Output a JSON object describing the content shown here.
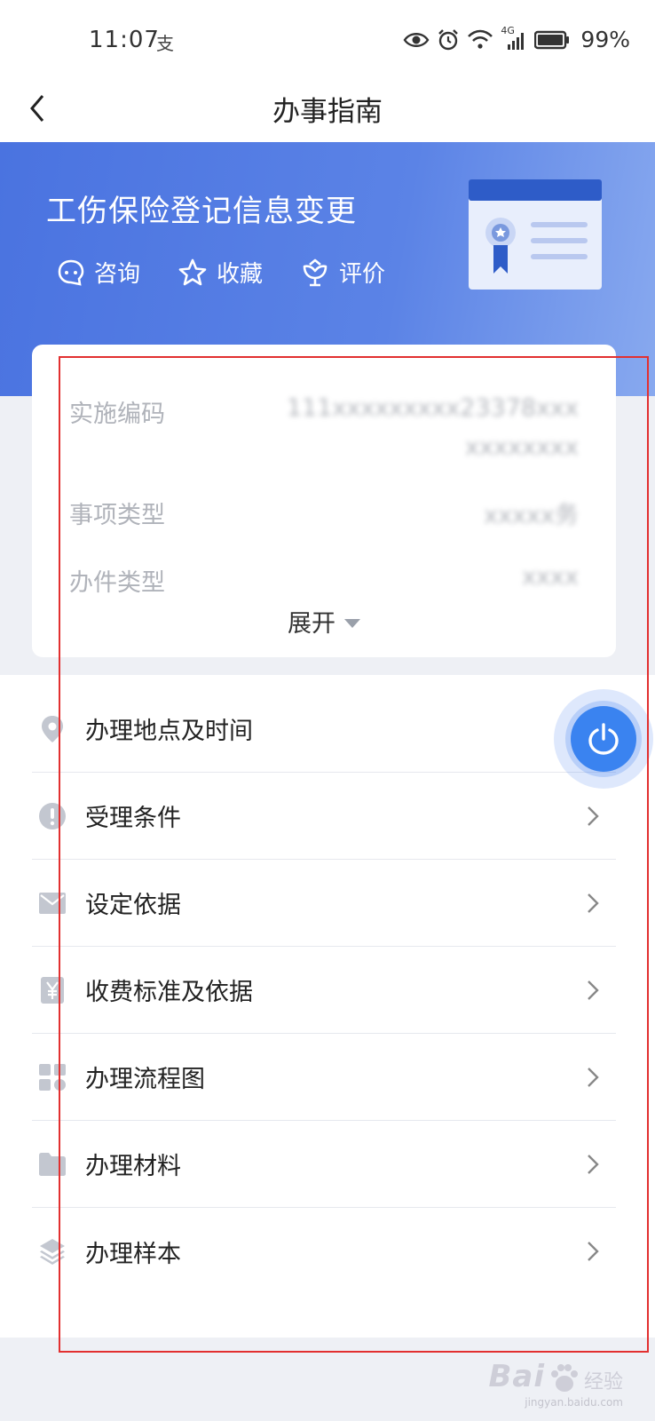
{
  "status_bar": {
    "time": "11:07",
    "time_glyph": "支",
    "network": "4G",
    "battery": "99%"
  },
  "nav": {
    "title": "办事指南",
    "back_icon": "chevron-left-icon"
  },
  "hero": {
    "title": "工伤保险登记信息变更",
    "actions": [
      {
        "label": "咨询",
        "icon": "chat-icon"
      },
      {
        "label": "收藏",
        "icon": "star-icon"
      },
      {
        "label": "评价",
        "icon": "flower-icon"
      }
    ],
    "gradient": [
      "#4a73e0",
      "#88a9ef"
    ]
  },
  "info_card": {
    "rows": [
      {
        "label": "实施编码",
        "value": "111xxxxxxxxx23378xxx\nxxxxxxxx"
      },
      {
        "label": "事项类型",
        "value": "xxxxx务"
      },
      {
        "label": "办件类型",
        "value": "xxxx"
      }
    ],
    "expand_label": "展开"
  },
  "menu": {
    "items": [
      {
        "label": "办理地点及时间",
        "icon": "location-pin-icon"
      },
      {
        "label": "受理条件",
        "icon": "exclamation-circle-icon"
      },
      {
        "label": "设定依据",
        "icon": "envelope-icon"
      },
      {
        "label": "收费标准及依据",
        "icon": "yuan-icon"
      },
      {
        "label": "办理流程图",
        "icon": "grid-icon"
      },
      {
        "label": "办理材料",
        "icon": "folder-icon"
      },
      {
        "label": "办理样本",
        "icon": "layers-icon"
      }
    ]
  },
  "watermark": {
    "main": "Bai",
    "sub": "经验",
    "url": "jingyan.baidu.com"
  },
  "colors": {
    "accent": "#3a83f0",
    "highlight_frame": "#e23030"
  }
}
